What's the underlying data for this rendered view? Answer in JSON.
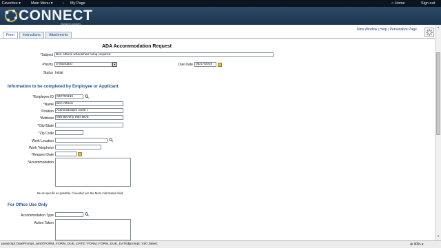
{
  "topbar": {
    "favorites": "Favorites",
    "main_menu": "Main Menu",
    "separator": "›",
    "my_page": "My Page",
    "home": "Home",
    "signout": "Sign out"
  },
  "banner": {
    "logo_text": "CONNECT",
    "subtitle": "Maryland Judiciary"
  },
  "tabs": [
    {
      "label": "Form"
    },
    {
      "label": "Instructions"
    },
    {
      "label": "Attachments"
    }
  ],
  "page_links": {
    "new_window": "New Window",
    "sep1": "|",
    "help": "Help",
    "sep2": "|",
    "personalize": "Personalize Page"
  },
  "form": {
    "title": "ADA Accommodation Request",
    "subject_label": "*Subject",
    "subject_value": "Ben Affleck wheelchair ramp required",
    "priority_label": "Priority",
    "priority_value": "3-Standard",
    "due_date_label": "Due Date",
    "due_date_value": "05/17/2015",
    "status_label": "Status",
    "status_value": "Initial"
  },
  "employee_section": {
    "heading": "Information to be completed by Employee or Applicant",
    "employee_id_label": "*Employee ID",
    "employee_id_value": "000700196",
    "name_label": "*Name",
    "name_value": "Ben Affleck",
    "position_label": "Position",
    "position_value": "Administrative Clerk I",
    "address_label": "*Address",
    "address_value": "948 Beverly Hills Blvd.",
    "city_label": "*City/State",
    "city_value": "",
    "zip_label": "*Zip Code",
    "zip_value": "",
    "work_location_label": "Work Location",
    "work_location_value": "",
    "work_telephone_label": "Work Telephone",
    "work_telephone_value": "",
    "request_date_label": "*Request Date",
    "request_date_value": "",
    "accommodation_label": "*Accommodation",
    "accommodation_value": "",
    "hint": "Be as specific as possible. If needed use the More information field."
  },
  "office_section": {
    "heading": "For Office Use Only",
    "accommodation_type_label": "Accommodation Type",
    "accommodation_type_value": "",
    "action_taken_label": "Action Taken",
    "action_taken_value": ""
  },
  "statusbar": {
    "text": "javascript:DatePrompt_win0('FORM_FORM_DUE_DATE','FORM_FORM_DUE_DATE$prompt','450',false);",
    "zoom": "90%"
  },
  "colors": {
    "topbar": "#0b1520",
    "banner": "#1d3650",
    "section_heading": "#1d4f8c",
    "link": "#1d3f78"
  }
}
